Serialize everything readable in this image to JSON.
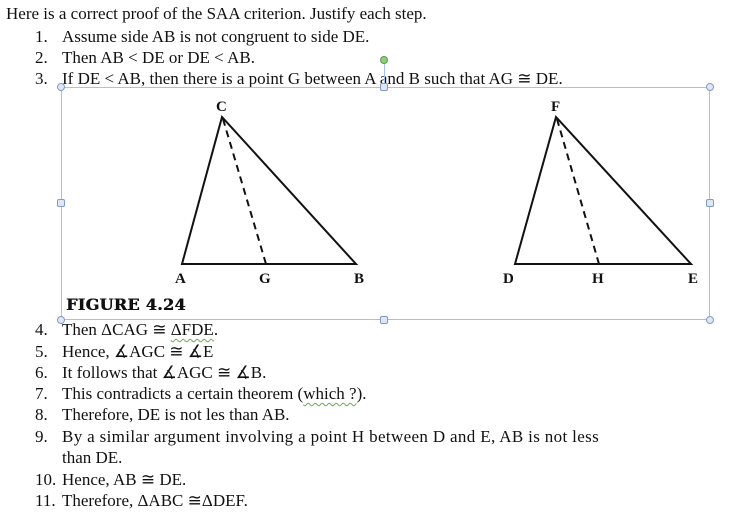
{
  "intro": "Here is a correct proof of the SAA criterion. Justify each step.",
  "steps": [
    {
      "num": "1.",
      "text": "Assume side AB is not congruent to side DE."
    },
    {
      "num": "2.",
      "text": "Then AB < DE or DE < AB."
    },
    {
      "num": "3.",
      "text": "If DE < AB, then there is a point G between A and B such that AG ≅ DE."
    },
    {
      "num": "4.",
      "text_pre": "Then ΔCAG ≅ ",
      "text_squiggle": " ΔFDE",
      "text_post": "."
    },
    {
      "num": "5.",
      "text": "Hence, ∡AGC ≅ ∡E"
    },
    {
      "num": "6.",
      "text": "It follows that ∡AGC ≅ ∡B."
    },
    {
      "num": "7.",
      "text_pre": "This contradicts a certain theorem (",
      "text_squiggle": "which ?",
      "text_post": ")."
    },
    {
      "num": "8.",
      "text": "Therefore, DE is not les than AB."
    },
    {
      "num": "9.",
      "text": "By a similar argument involving a point H between D and E, AB is not less",
      "text_cont": "than DE."
    },
    {
      "num": "10.",
      "text": "Hence, AB ≅ DE."
    },
    {
      "num": "11.",
      "text": "Therefore, ΔABC ≅ΔDEF."
    }
  ],
  "figure": {
    "caption": "FIGURE 4.24",
    "triangle1": {
      "apex": "C",
      "left": "A",
      "right": "B",
      "foot": "G"
    },
    "triangle2": {
      "apex": "F",
      "left": "D",
      "right": "E",
      "foot": "H"
    }
  },
  "colors": {
    "selection_border": "#a9c1e6",
    "rotate_handle": "#8fce7f",
    "spell_squiggle": "#6aa84f"
  }
}
